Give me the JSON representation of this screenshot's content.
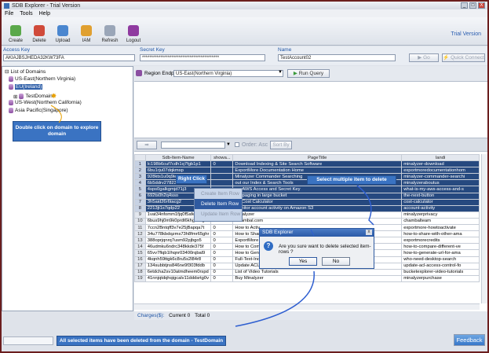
{
  "window": {
    "title": "SDB Explorer - Trial Version",
    "controls": [
      "_",
      "□",
      "X"
    ]
  },
  "menu": [
    "File",
    "Tools",
    "Help"
  ],
  "toolbar": {
    "buttons": [
      "Create",
      "Delete",
      "Upload",
      "IAM",
      "Refresh",
      "Logout"
    ],
    "trial_label": "Trial Version"
  },
  "keys": {
    "access_label": "Access Key",
    "access_value": "AKIAJBSJHEDA32KW73FA",
    "secret_label": "Secret Key",
    "secret_value": "******************************************",
    "name_label": "Name",
    "name_value": "TestAccount02",
    "go_label": "Go",
    "quick_connect_label": "Quick Connect"
  },
  "tree": {
    "root": "List of Domains",
    "items": [
      "US-East(Northern Virginia)",
      "EU(Ireland)",
      "TestDomain",
      "US-West(Northern California)",
      "Asia Pacific(Singapore)"
    ]
  },
  "hint_left": "Double click on domain to explore domain",
  "region": {
    "label": "Region Endpoint",
    "value": "US-East(Northern Virginia)",
    "run_label": "Run Query"
  },
  "querybar": {
    "order_label": "Order: Asc",
    "sort_label": "Sort By"
  },
  "grid": {
    "headers": [
      "",
      "Sdb-Item-Name",
      "showa...",
      "PageTitle",
      "landi"
    ],
    "rows": [
      [
        "1",
        "lc198b6cuf7cdh1q7fgb1p1",
        "0",
        "Download Indexing & Site Search Software",
        "minalyzer-download"
      ],
      [
        "2",
        "6bu1rju07dqkmsp",
        "",
        "ExportMore Documentation Home",
        "exportmoredocumentationhom"
      ],
      [
        "3",
        "928kts1u0q9ie9s",
        "",
        "Minalyzer Commander Searching",
        "minalyzer-commander-searchi"
      ],
      [
        "4",
        "6b5ddrv27823bolt",
        "",
        "out our Index & Search Tools",
        "minalyzeraboutus"
      ],
      [
        "5",
        "4sps0galkgmjd71j3",
        "",
        "my AWS Access and Secret Key",
        "what-is-my-aws-access-and-s"
      ],
      [
        "6",
        "692ts0h2q4sso",
        "",
        "set paging in large bucket",
        "the-next-button"
      ],
      [
        "7",
        "3h5aid26r6tacg2",
        "",
        "S3 Cost Calculator",
        "cost-calculator"
      ],
      [
        "8",
        "2213jt1s7qdp22",
        "",
        "monitor account activity on Amazon S3",
        "account-activity"
      ],
      [
        "9",
        "1vat34nfomm1fjq0f5afe3er",
        "0",
        "Minalyzer",
        "minalyzerprivacy"
      ],
      [
        "10",
        "6bus9hj0m9k0prdt6khgvnngf",
        "0",
        "Chambal.com",
        "chambalteam"
      ],
      [
        "11",
        "7ccn2Bntqff3v7e25jBapqa7t",
        "0",
        "How to Activ",
        "exportmore-howtoactivate"
      ],
      [
        "12",
        "34u778kbdqzms73h8fmr65ghr",
        "0",
        "How to Shar",
        "how-to-share-with-other-ama"
      ],
      [
        "13",
        "388oprjqnrq7usm92pjbgo5",
        "0",
        "ExportMore",
        "exportmorecredits"
      ],
      [
        "14",
        "46udmku6ndrc348kkde375f",
        "0",
        "How to Com",
        "how-to-compare-different-ve"
      ],
      [
        "15",
        "65vv7flqb1Ihqnr03400rqbal9",
        "0",
        "How to Gen",
        "how-to-generate-url-for-ama"
      ],
      [
        "16",
        "4kqnh59ttgk6c8ru5s2l84r8",
        "0",
        "Full-Text-Index : Who Needs Desktop Search ?",
        "who-need-desktop-search"
      ],
      [
        "17",
        "134subbtjns846ne9f303fddb",
        "0",
        "Update ACL Access Control for Bucket",
        "update-acl-access-control-fo"
      ],
      [
        "18",
        "6etdcha2sv10atmdheem0rspd",
        "0",
        "List of Video Tutorials",
        "bucketexplorer-video-tutorials"
      ],
      [
        "19",
        "41nnjqtdqhqigcalv11dddsrtg0v",
        "0",
        "Buy Minalyzer",
        "minalyzerpurchase"
      ]
    ]
  },
  "context_menu": {
    "callout": "Right Click",
    "items": [
      "Create Item Row",
      "Delete Item Row",
      "Update Item Row"
    ]
  },
  "callout_multi": "Select multiple item to delete",
  "dialog": {
    "title": "SDB Explorer",
    "message": "Are you sure want to delete selected item-rows ?",
    "yes": "Yes",
    "no": "No"
  },
  "status": {
    "charges_label": "Charges($):",
    "current": "Current 0",
    "total": "Total 0"
  },
  "callout_bottom": "All selected items have been deleted from the domain - TestDomain",
  "feedback_label": "Feedback",
  "colors": {
    "accent": "#2f5aa0",
    "callout": "#3a73c2",
    "selection": "#26497f",
    "frame": "#6b1e1e"
  }
}
